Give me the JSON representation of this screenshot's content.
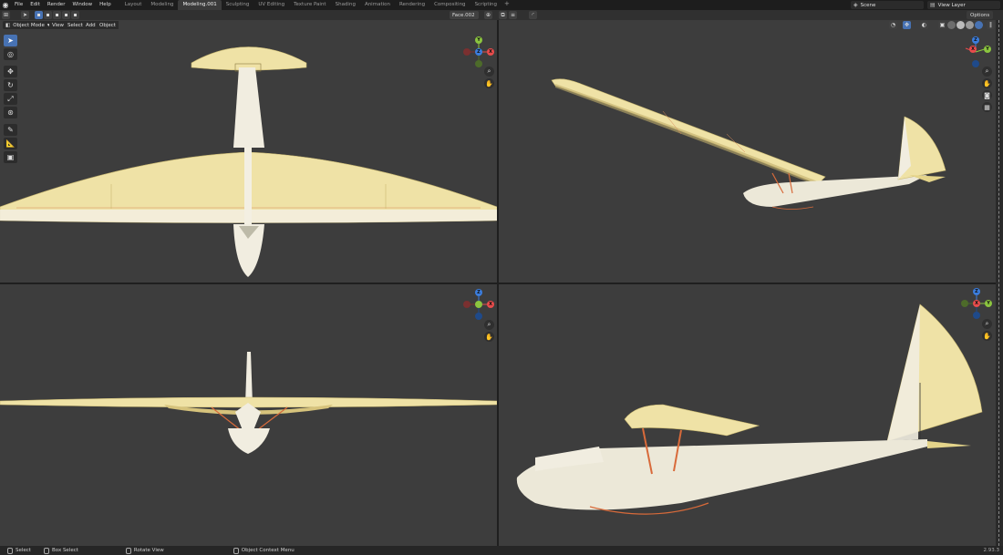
{
  "topbar": {
    "menu": [
      "File",
      "Edit",
      "Render",
      "Window",
      "Help"
    ],
    "workspaces": [
      "Layout",
      "Modeling",
      "Modeling.001",
      "Sculpting",
      "UV Editing",
      "Texture Paint",
      "Shading",
      "Animation",
      "Rendering",
      "Compositing",
      "Scripting"
    ],
    "active_workspace": "Modeling.001",
    "scene": "Scene",
    "view_layer": "View Layer"
  },
  "header": {
    "object_name": "Face.002",
    "options": "Options"
  },
  "viewport_header": {
    "mode": "Object Mode",
    "menus": [
      "View",
      "Select",
      "Add",
      "Object"
    ]
  },
  "gizmo_axes": {
    "x": "X",
    "y": "Y",
    "z": "Z"
  },
  "colors": {
    "viewport_bg": "#3d3d3d",
    "axis_x": "#e84c4c",
    "axis_y": "#8bc53f",
    "axis_z": "#3b7ddd",
    "accent": "#4772b3",
    "wing_fabric": "#efe2a6",
    "frame": "#e9e6d8"
  },
  "status": {
    "items": [
      "Select",
      "Box Select",
      "Rotate View",
      "Object Context Menu"
    ],
    "version": "2.93.3"
  }
}
